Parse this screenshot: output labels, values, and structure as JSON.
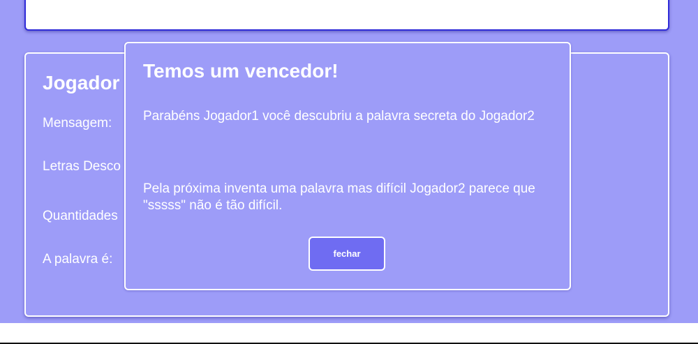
{
  "player_panel": {
    "title": "Jogador",
    "message_label": "Mensagem:",
    "letters_label": "Letras Desco",
    "quantity_label": "Quantidades",
    "word_label": "A palavra é:"
  },
  "modal": {
    "title": "Temos um vencedor!",
    "line1": "Parabéns Jogador1 você descubriu a palavra secreta do Jogador2",
    "line2": "Pela próxima inventa uma palavra mas difícil Jogador2 parece que \"sssss\" não é tão difícil.",
    "close_label": "fechar"
  },
  "colors": {
    "background": "#9d9cf8",
    "button": "#6f6cf2",
    "top_card_border": "#2f2bd8"
  }
}
